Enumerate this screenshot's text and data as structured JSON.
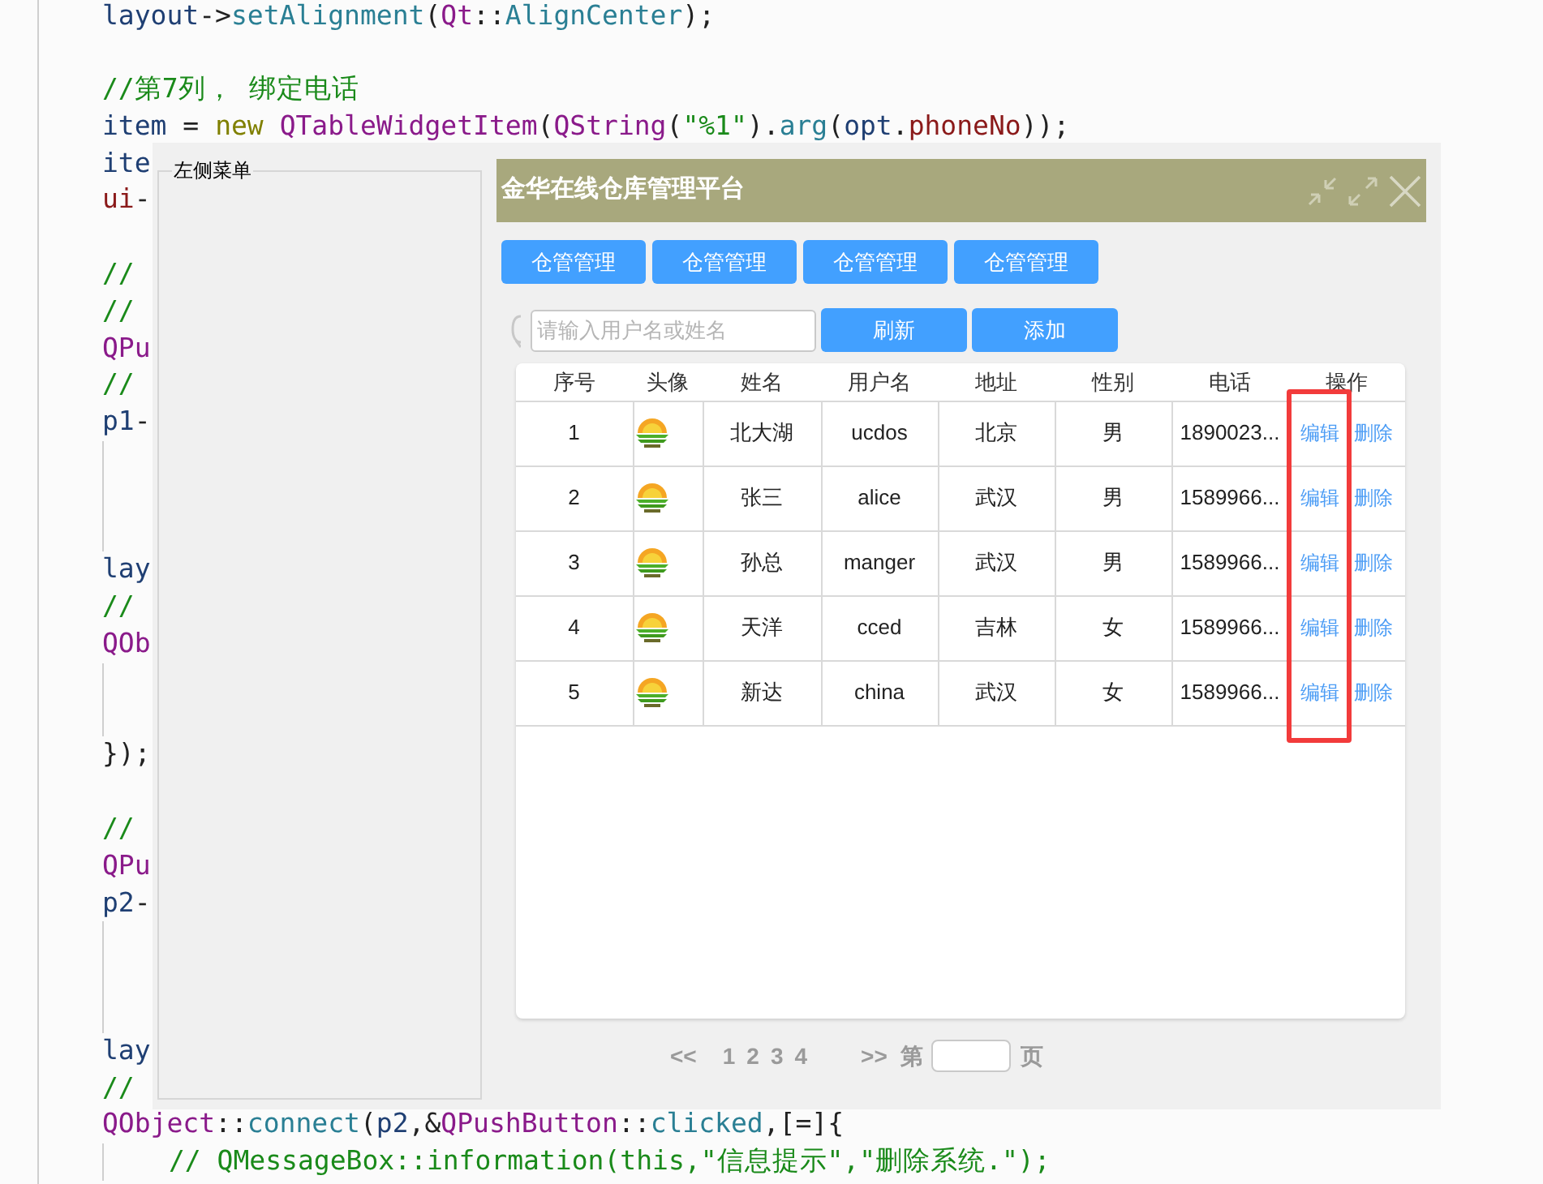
{
  "editor": {
    "lines": [
      {
        "kind": "code",
        "tokens": [
          {
            "kind": "ident",
            "text": "layout"
          },
          {
            "kind": "punct",
            "text": "->"
          },
          {
            "kind": "func",
            "text": "setAlignment"
          },
          {
            "kind": "punct",
            "text": "("
          },
          {
            "kind": "type",
            "text": "Qt"
          },
          {
            "kind": "punct",
            "text": "::"
          },
          {
            "kind": "func",
            "text": "AlignCenter"
          },
          {
            "kind": "punct",
            "text": ");"
          }
        ]
      },
      {
        "kind": "blank"
      },
      {
        "kind": "code",
        "tokens": [
          {
            "kind": "comment",
            "text": "//第7列， 绑定电话"
          }
        ]
      },
      {
        "kind": "code",
        "tokens": [
          {
            "kind": "ident",
            "text": "item"
          },
          {
            "kind": "punct",
            "text": " = "
          },
          {
            "kind": "keyword",
            "text": "new "
          },
          {
            "kind": "type",
            "text": "QTableWidgetItem"
          },
          {
            "kind": "punct",
            "text": "("
          },
          {
            "kind": "type",
            "text": "QString"
          },
          {
            "kind": "punct",
            "text": "("
          },
          {
            "kind": "string",
            "text": "\"%1\""
          },
          {
            "kind": "punct",
            "text": ")."
          },
          {
            "kind": "func",
            "text": "arg"
          },
          {
            "kind": "punct",
            "text": "("
          },
          {
            "kind": "ident",
            "text": "opt"
          },
          {
            "kind": "punct",
            "text": "."
          },
          {
            "kind": "field",
            "text": "phoneNo"
          },
          {
            "kind": "punct",
            "text": "));"
          }
        ]
      },
      {
        "kind": "code",
        "tokens": [
          {
            "kind": "ident",
            "text": "ite"
          }
        ]
      },
      {
        "kind": "code",
        "tokens": [
          {
            "kind": "field",
            "text": "ui"
          },
          {
            "kind": "punct",
            "text": "-"
          }
        ]
      },
      {
        "kind": "blank"
      },
      {
        "kind": "code",
        "tokens": [
          {
            "kind": "comment",
            "text": "//"
          }
        ]
      },
      {
        "kind": "code",
        "tokens": [
          {
            "kind": "comment",
            "text": "//"
          }
        ]
      },
      {
        "kind": "code",
        "tokens": [
          {
            "kind": "type",
            "text": "QPu"
          }
        ]
      },
      {
        "kind": "code",
        "tokens": [
          {
            "kind": "comment",
            "text": "//"
          }
        ]
      },
      {
        "kind": "code",
        "tokens": [
          {
            "kind": "ident",
            "text": "p1"
          },
          {
            "kind": "punct",
            "text": "-"
          }
        ]
      },
      {
        "kind": "guide"
      },
      {
        "kind": "guide"
      },
      {
        "kind": "guide"
      },
      {
        "kind": "code",
        "tokens": [
          {
            "kind": "ident",
            "text": "lay"
          }
        ]
      },
      {
        "kind": "code",
        "tokens": [
          {
            "kind": "comment",
            "text": "//"
          }
        ]
      },
      {
        "kind": "code",
        "tokens": [
          {
            "kind": "type",
            "text": "QOb"
          }
        ]
      },
      {
        "kind": "guide"
      },
      {
        "kind": "guide"
      },
      {
        "kind": "code",
        "tokens": [
          {
            "kind": "punct",
            "text": "});"
          }
        ]
      },
      {
        "kind": "blank"
      },
      {
        "kind": "code",
        "tokens": [
          {
            "kind": "comment",
            "text": "//"
          }
        ]
      },
      {
        "kind": "code",
        "tokens": [
          {
            "kind": "type",
            "text": "QPu"
          }
        ]
      },
      {
        "kind": "code",
        "tokens": [
          {
            "kind": "ident",
            "text": "p2"
          },
          {
            "kind": "punct",
            "text": "-"
          }
        ]
      },
      {
        "kind": "guide"
      },
      {
        "kind": "guide"
      },
      {
        "kind": "guide"
      },
      {
        "kind": "code",
        "tokens": [
          {
            "kind": "ident",
            "text": "lay"
          }
        ]
      },
      {
        "kind": "code",
        "tokens": [
          {
            "kind": "comment",
            "text": "//"
          }
        ]
      },
      {
        "kind": "code",
        "tokens": [
          {
            "kind": "type",
            "text": "QObject"
          },
          {
            "kind": "punct",
            "text": "::"
          },
          {
            "kind": "func",
            "text": "connect"
          },
          {
            "kind": "punct",
            "text": "("
          },
          {
            "kind": "ident",
            "text": "p2"
          },
          {
            "kind": "punct",
            "text": ",&"
          },
          {
            "kind": "type",
            "text": "QPushButton"
          },
          {
            "kind": "punct",
            "text": "::"
          },
          {
            "kind": "func",
            "text": "clicked"
          },
          {
            "kind": "punct",
            "text": ",[=]{"
          }
        ]
      },
      {
        "kind": "indented",
        "tokens": [
          {
            "kind": "comment",
            "text": "// QMessageBox::information(this,\"信息提示\",\"删除系统.\");"
          }
        ]
      }
    ]
  },
  "window": {
    "sidebar": {
      "title": "左侧菜单"
    },
    "title": "金华在线仓库管理平台",
    "nav_buttons": [
      {
        "label": "仓管管理"
      },
      {
        "label": "仓管管理"
      },
      {
        "label": "仓管管理"
      },
      {
        "label": "仓管管理"
      }
    ],
    "search": {
      "placeholder": "请输入用户名或姓名"
    },
    "actions": [
      "刷新",
      "添加"
    ],
    "table": {
      "columns": [
        {
          "label": "序号",
          "kind": "text"
        },
        {
          "label": "头像",
          "kind": "avatar"
        },
        {
          "label": "姓名",
          "kind": "text"
        },
        {
          "label": "用户名",
          "kind": "text"
        },
        {
          "label": "地址",
          "kind": "text"
        },
        {
          "label": "性别",
          "kind": "text"
        },
        {
          "label": "电话",
          "kind": "text"
        },
        {
          "label": "操作",
          "kind": "actions"
        }
      ],
      "rows": [
        {
          "values": [
            "1",
            "北大湖",
            "ucdos",
            "北京",
            "男",
            "1890023..."
          ],
          "actions": [
            "编辑",
            "删除"
          ]
        },
        {
          "values": [
            "2",
            "张三",
            "alice",
            "武汉",
            "男",
            "1589966..."
          ],
          "actions": [
            "编辑",
            "删除"
          ]
        },
        {
          "values": [
            "3",
            "孙总",
            "manger",
            "武汉",
            "男",
            "1589966..."
          ],
          "actions": [
            "编辑",
            "删除"
          ]
        },
        {
          "values": [
            "4",
            "天洋",
            "cced",
            "吉林",
            "女",
            "1589966..."
          ],
          "actions": [
            "编辑",
            "删除"
          ]
        },
        {
          "values": [
            "5",
            "新达",
            "china",
            "武汉",
            "女",
            "1589966..."
          ],
          "actions": [
            "编辑",
            "删除"
          ]
        }
      ]
    },
    "pagination": {
      "prev": "<<",
      "pages": [
        "1",
        "2",
        "3",
        "4"
      ],
      "next": ">>",
      "prefix": "第",
      "suffix": "页"
    }
  }
}
